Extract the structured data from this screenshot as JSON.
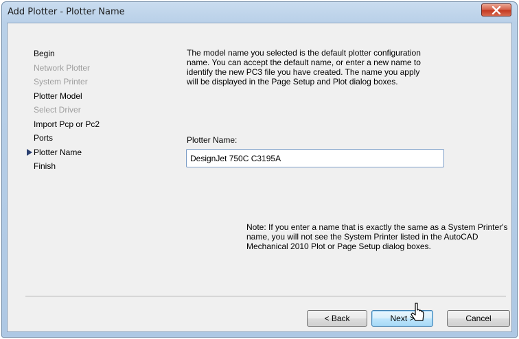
{
  "window": {
    "title": "Add Plotter - Plotter Name",
    "close_glyph": "✕"
  },
  "steps": [
    {
      "label": "Begin",
      "state": "enabled"
    },
    {
      "label": "Network Plotter",
      "state": "disabled"
    },
    {
      "label": "System Printer",
      "state": "disabled"
    },
    {
      "label": "Plotter Model",
      "state": "enabled"
    },
    {
      "label": "Select Driver",
      "state": "disabled"
    },
    {
      "label": "Import Pcp or Pc2",
      "state": "enabled"
    },
    {
      "label": "Ports",
      "state": "enabled"
    },
    {
      "label": "Plotter Name",
      "state": "current"
    },
    {
      "label": "Finish",
      "state": "enabled"
    }
  ],
  "main": {
    "description": "The model name you selected is the default plotter configuration name. You can accept the default name, or enter a new name to identify the new PC3 file you have created. The name you apply will be displayed in the Page Setup and Plot dialog boxes.",
    "name_label": "Plotter Name:",
    "name_value": "DesignJet 750C C3195A",
    "note": "Note: If you enter a name that is exactly the same as a System Printer's name, you will not see the System Printer listed in the AutoCAD Mechanical 2010 Plot or Page Setup dialog boxes."
  },
  "buttons": {
    "back": "< Back",
    "next": "Next >",
    "cancel": "Cancel"
  },
  "colors": {
    "titlebar": "#b9d0e8",
    "close_button": "#c43a22",
    "dialog_bg": "#f0f0f0",
    "disabled_text": "#9e9e9e",
    "current_step_arrow": "#2a3f70"
  }
}
